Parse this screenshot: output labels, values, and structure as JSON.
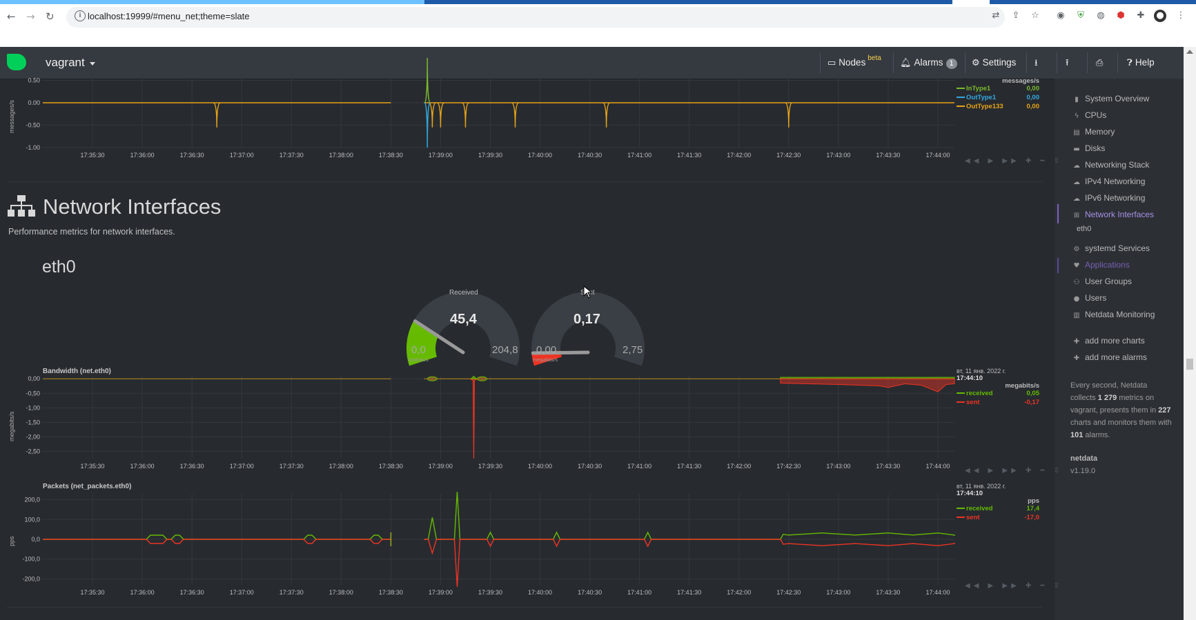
{
  "browser": {
    "url": "localhost:19999/#menu_net;theme=slate"
  },
  "header": {
    "hostname": "vagrant",
    "nodes_label": "Nodes",
    "nodes_badge": "beta",
    "alarms_label": "Alarms",
    "alarms_count": "1",
    "settings_label": "Settings",
    "help_label": "Help"
  },
  "sidebar": {
    "items": [
      {
        "label": "System Overview",
        "icon": "bookmark-icon"
      },
      {
        "label": "CPUs",
        "icon": "bolt-icon"
      },
      {
        "label": "Memory",
        "icon": "memory-icon"
      },
      {
        "label": "Disks",
        "icon": "hdd-icon"
      },
      {
        "label": "Networking Stack",
        "icon": "cloud-icon"
      },
      {
        "label": "IPv4 Networking",
        "icon": "cloud-icon"
      },
      {
        "label": "IPv6 Networking",
        "icon": "cloud-icon"
      },
      {
        "label": "Network Interfaces",
        "icon": "sitemap-icon"
      },
      {
        "label": "eth0",
        "icon": ""
      },
      {
        "label": "systemd Services",
        "icon": "cogs-icon"
      },
      {
        "label": "Applications",
        "icon": "heart-icon"
      },
      {
        "label": "User Groups",
        "icon": "users-icon"
      },
      {
        "label": "Users",
        "icon": "user-icon"
      },
      {
        "label": "Netdata Monitoring",
        "icon": "bar-chart-icon"
      }
    ],
    "add_charts": "add more charts",
    "add_alarms": "add more alarms",
    "info": {
      "p1": "Every second, Netdata collects ",
      "metrics": "1 279",
      "p2": " metrics on vagrant, presents them in ",
      "charts": "227",
      "p3": " charts and monitors them with ",
      "alarms": "101",
      "p4": " alarms."
    },
    "version_label": "netdata",
    "version": "v1.19.0"
  },
  "section": {
    "title": "Network Interfaces",
    "description": "Performance metrics for network interfaces.",
    "family": "eth0"
  },
  "gauges": [
    {
      "title": "Received",
      "value": "45,4",
      "min": "0,0",
      "max": "204,8",
      "unit": "kilobits/s",
      "color": "#66bb00",
      "fraction": 0.22
    },
    {
      "title": "Sent",
      "value": "0,17",
      "min": "0,00",
      "max": "2,75",
      "unit": "megabits/s",
      "color": "#ee3322",
      "fraction": 0.06
    }
  ],
  "time_ticks": [
    "17:35:30",
    "17:36:00",
    "17:36:30",
    "17:37:00",
    "17:37:30",
    "17:38:00",
    "17:38:30",
    "17:39:00",
    "17:39:30",
    "17:40:00",
    "17:40:30",
    "17:41:00",
    "17:41:30",
    "17:42:00",
    "17:42:30",
    "17:43:00",
    "17:43:30",
    "17:44:00"
  ],
  "chart_data": [
    {
      "type": "line",
      "title": "",
      "ylabel": "messages/s",
      "unit": "messages/s",
      "yticks": [
        "0.50",
        "0.00",
        "-0.50",
        "-1.00"
      ],
      "ylim": [
        -1.0,
        0.6
      ],
      "series": [
        {
          "name": "InType1",
          "color": "#7bbb2b",
          "current": "0,00",
          "x": [
            "17:38:50",
            "17:38:52",
            "17:38:54"
          ],
          "y": [
            0,
            1.0,
            0
          ]
        },
        {
          "name": "OutType1",
          "color": "#33a8e0",
          "current": "0,00",
          "x": [
            "17:38:50",
            "17:38:52",
            "17:38:54"
          ],
          "y": [
            0,
            -1.0,
            0
          ]
        },
        {
          "name": "OutType133",
          "color": "#e8a317",
          "current": "0,00",
          "x": [
            "17:36:45",
            "17:38:55",
            "17:39:00",
            "17:39:15",
            "17:39:45",
            "17:40:40",
            "17:42:30"
          ],
          "y": [
            -0.55,
            -0.55,
            -0.55,
            -0.55,
            -0.55,
            -0.55,
            -0.55
          ]
        }
      ]
    },
    {
      "type": "area",
      "title": "Bandwidth (net.eth0)",
      "ylabel": "megabits/s",
      "unit": "megabits/s",
      "timestamp_date": "вт, 11 янв. 2022 г.",
      "timestamp_time": "17:44:10",
      "yticks": [
        "0,00",
        "-0,50",
        "-1,00",
        "-1,50",
        "-2,00",
        "-2,50"
      ],
      "ylim": [
        -2.75,
        0.1
      ],
      "series": [
        {
          "name": "received",
          "color": "#66bb00",
          "current": "0,05",
          "x": [
            "17:39:10",
            "17:39:20",
            "17:42:25",
            "17:44:10"
          ],
          "y": [
            0,
            0.09,
            0.05,
            0.05
          ]
        },
        {
          "name": "sent",
          "color": "#ee3322",
          "current": "-0,17",
          "x": [
            "17:39:10",
            "17:39:20",
            "17:42:25",
            "17:43:30",
            "17:44:00",
            "17:44:10"
          ],
          "y": [
            0,
            -2.75,
            -0.15,
            -0.3,
            -0.45,
            -0.17
          ]
        }
      ]
    },
    {
      "type": "line",
      "title": "Packets (net_packets.eth0)",
      "ylabel": "pps",
      "unit": "pps",
      "timestamp_date": "вт, 11 янв. 2022 г.",
      "timestamp_time": "17:44:10",
      "yticks": [
        "200,0",
        "100,0",
        "0,0",
        "-100,0",
        "-200,0"
      ],
      "ylim": [
        -230,
        230
      ],
      "series": [
        {
          "name": "received",
          "color": "#66bb00",
          "current": "17,4",
          "x": [
            "17:38:55",
            "17:39:10",
            "17:42:25",
            "17:44:10"
          ],
          "y": [
            110,
            240,
            25,
            17.4
          ]
        },
        {
          "name": "sent",
          "color": "#ee3322",
          "current": "-17,0",
          "x": [
            "17:38:55",
            "17:39:10",
            "17:42:25",
            "17:44:10"
          ],
          "y": [
            -70,
            -240,
            -25,
            -17.0
          ]
        }
      ]
    }
  ]
}
